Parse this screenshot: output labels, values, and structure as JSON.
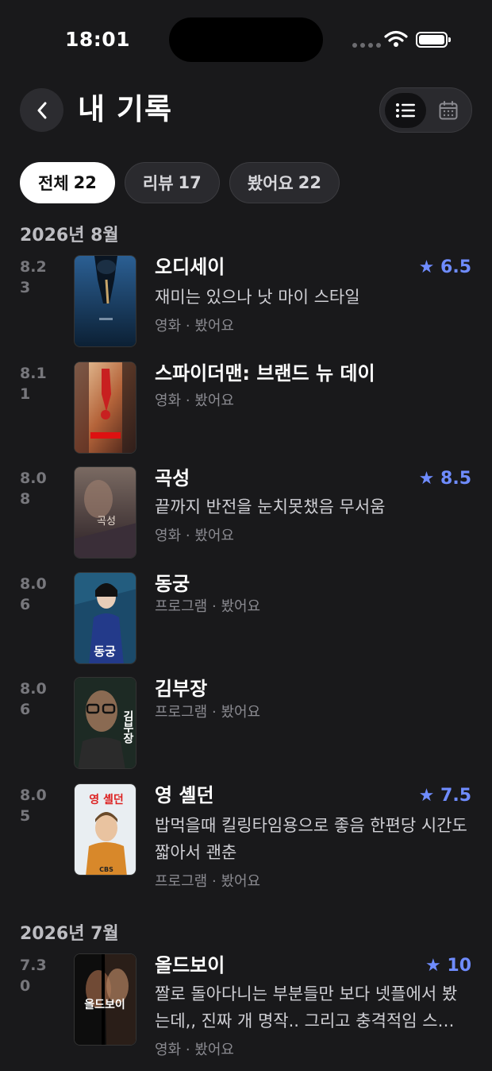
{
  "status": {
    "time": "18:01"
  },
  "header": {
    "title": "내 기록",
    "back_icon": "chevron-left-icon",
    "list_icon": "list-icon",
    "calendar_icon": "calendar-icon"
  },
  "filters": [
    {
      "label": "전체",
      "count": "22",
      "active": true
    },
    {
      "label": "리뷰",
      "count": "17",
      "active": false
    },
    {
      "label": "봤어요",
      "count": "22",
      "active": false
    }
  ],
  "accent": "#6f8cff",
  "sections": [
    {
      "month": "2026년 8월",
      "entries": [
        {
          "date": "8.23",
          "title": "오디세이",
          "rating": "★ 6.5",
          "review": "재미는 있으나 낫 마이 스타일",
          "category": "영화",
          "status": "봤어요"
        },
        {
          "date": "8.11",
          "title": "스파이더맨: 브랜드 뉴 데이",
          "rating": "",
          "review": "",
          "category": "영화",
          "status": "봤어요"
        },
        {
          "date": "8.08",
          "title": "곡성",
          "rating": "★ 8.5",
          "review": "끝까지 반전을 눈치못챘음 무서움",
          "category": "영화",
          "status": "봤어요",
          "poster_text": "곡성"
        },
        {
          "date": "8.06",
          "title": "동궁",
          "rating": "",
          "review": "",
          "category": "프로그램",
          "status": "봤어요",
          "poster_text": "동궁"
        },
        {
          "date": "8.06",
          "title": "김부장",
          "rating": "",
          "review": "",
          "category": "프로그램",
          "status": "봤어요",
          "poster_text": "김부장"
        },
        {
          "date": "8.05",
          "title": "영 셸던",
          "rating": "★ 7.5",
          "review": "밥먹을때 킬링타임용으로 좋음 한편당 시간도 짧아서 괜춘",
          "category": "프로그램",
          "status": "봤어요",
          "poster_text": "영 셸던",
          "poster_badge": "CBS"
        }
      ]
    },
    {
      "month": "2026년 7월",
      "entries": [
        {
          "date": "7.30",
          "title": "올드보이",
          "rating": "★ 10",
          "review": "짤로 돌아다니는 부분들만 보다 넷플에서 봤는데,, 진짜 개 명작.. 그리고 충격적임 스…",
          "category": "영화",
          "status": "봤어요",
          "poster_text": "올드보이"
        }
      ]
    }
  ]
}
